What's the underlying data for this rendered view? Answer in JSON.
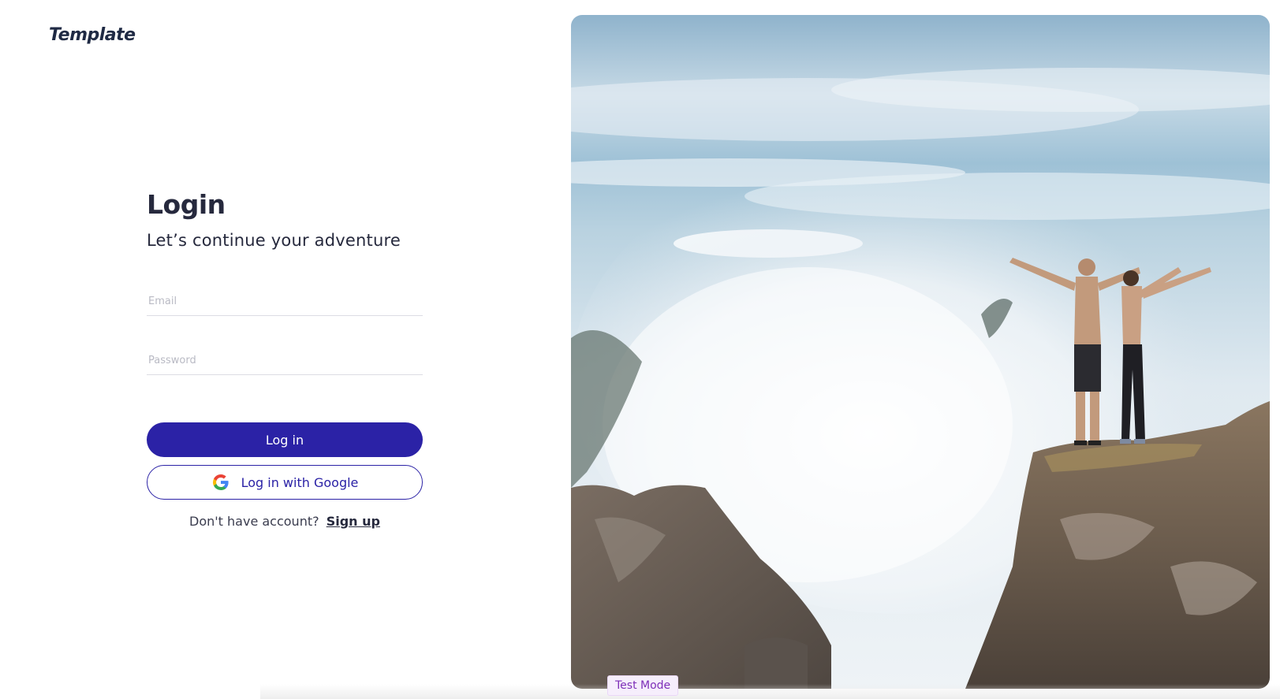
{
  "brand": {
    "logo_text": "Template"
  },
  "login": {
    "title": "Login",
    "subtitle": "Let’s continue your adventure",
    "email_placeholder": "Email",
    "password_placeholder": "Password",
    "login_button": "Log in",
    "google_button": "Log in with Google",
    "signup_prompt": "Don't have account?",
    "signup_link": "Sign up"
  },
  "badge": {
    "test_mode": "Test Mode"
  },
  "colors": {
    "primary": "#2b22a6",
    "text_dark": "#26293d",
    "badge_text": "#7e2fb8"
  },
  "icons": {
    "google": "google-icon"
  }
}
